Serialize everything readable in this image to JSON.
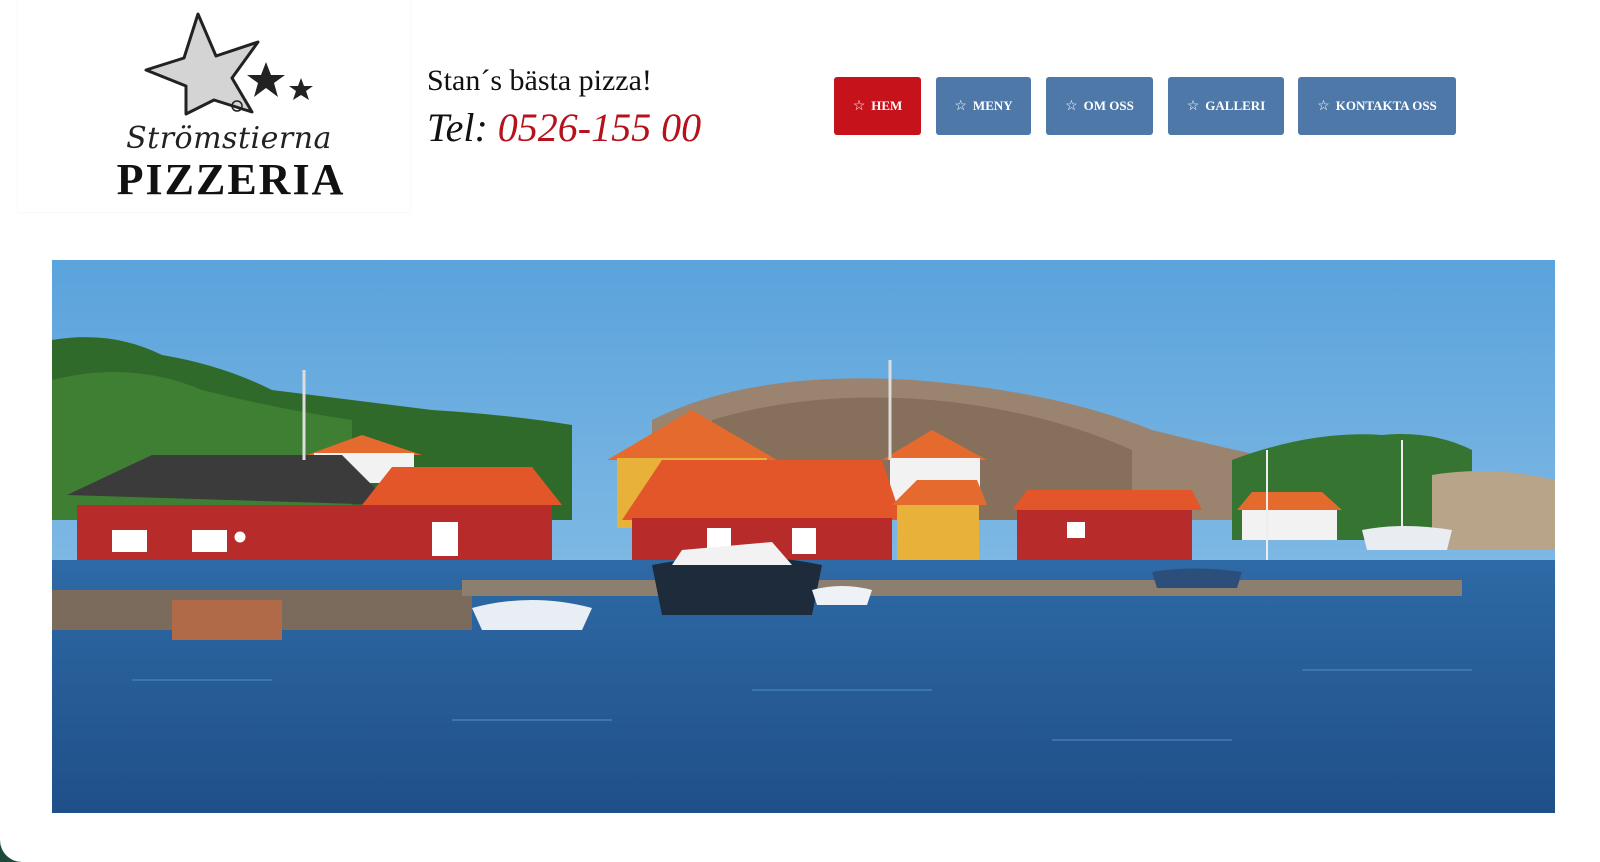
{
  "logo": {
    "script_text": "Strömstierna",
    "word_text": "PIZZERIA",
    "icon": "stars-logo-icon"
  },
  "header": {
    "tagline": "Stan´s bästa pizza!",
    "phone_prefix": "Tel: ",
    "phone_number": "0526-155 00"
  },
  "nav": {
    "items": [
      {
        "label": "HEM",
        "icon": "star-outline-icon",
        "active": true
      },
      {
        "label": "MENY",
        "icon": "star-outline-icon",
        "active": false
      },
      {
        "label": "OM OSS",
        "icon": "star-outline-icon",
        "active": false
      },
      {
        "label": "GALLERI",
        "icon": "star-outline-icon",
        "active": false
      },
      {
        "label": "KONTAKTA OSS",
        "icon": "star-outline-icon",
        "active": false
      }
    ]
  },
  "colors": {
    "accent_red": "#c5121b",
    "nav_blue": "#4e78a8",
    "phone_red": "#b5121b"
  }
}
